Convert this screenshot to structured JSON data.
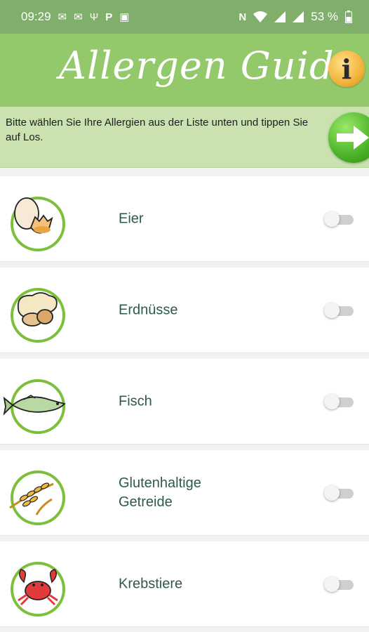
{
  "status_bar": {
    "time": "09:29",
    "battery": "53 %",
    "icons_left": [
      "message-icon",
      "message-icon",
      "usb-icon",
      "p-icon",
      "screenshot-icon"
    ],
    "icons_right": [
      "nfc-icon",
      "wifi-icon",
      "signal-icon",
      "signal-icon",
      "battery-icon"
    ]
  },
  "header": {
    "title": "Allergen Guide",
    "info_label": "i"
  },
  "instruction": {
    "text": "Bitte wählen Sie Ihre Allergien aus der Liste unten und tippen Sie auf Los."
  },
  "allergens": [
    {
      "label": "Eier",
      "icon": "egg-icon",
      "enabled": false
    },
    {
      "label": "Erdnüsse",
      "icon": "peanut-icon",
      "enabled": false
    },
    {
      "label": "Fisch",
      "icon": "fish-icon",
      "enabled": false
    },
    {
      "label": "Glutenhaltige Getreide",
      "icon": "wheat-icon",
      "enabled": false
    },
    {
      "label": "Krebstiere",
      "icon": "crab-icon",
      "enabled": false
    }
  ],
  "colors": {
    "status_bar": "#7faf6a",
    "header": "#93c96a",
    "instruction_bar": "#c9e2b0",
    "ring": "#7bbf3a",
    "label_text": "#2d5a4a"
  }
}
